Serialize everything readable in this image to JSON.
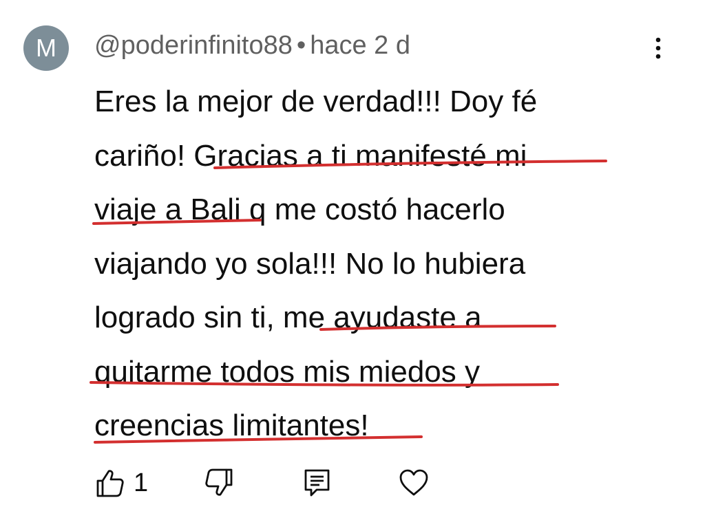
{
  "comment": {
    "avatar_letter": "M",
    "avatar_color": "#7d8e98",
    "author": "@poderinfinito88",
    "separator": "•",
    "time": "hace 2 d",
    "lines": [
      "Eres la mejor de verdad!!! Doy fé",
      "cariño! Gracias a ti manifesté mi",
      "viaje a Bali q me costó hacerlo",
      "viajando yo sola!!! No lo hubiera",
      "logrado sin ti, me ayudaste a",
      "quitarme todos mis miedos y",
      "creencias limitantes!"
    ],
    "underline_color": "#d32f2f"
  },
  "actions": {
    "like_icon": "thumbs-up-icon",
    "like_count": "1",
    "dislike_icon": "thumbs-down-icon",
    "reply_icon": "reply-comment-icon",
    "heart_icon": "heart-icon",
    "more_icon": "more-vertical-icon"
  }
}
